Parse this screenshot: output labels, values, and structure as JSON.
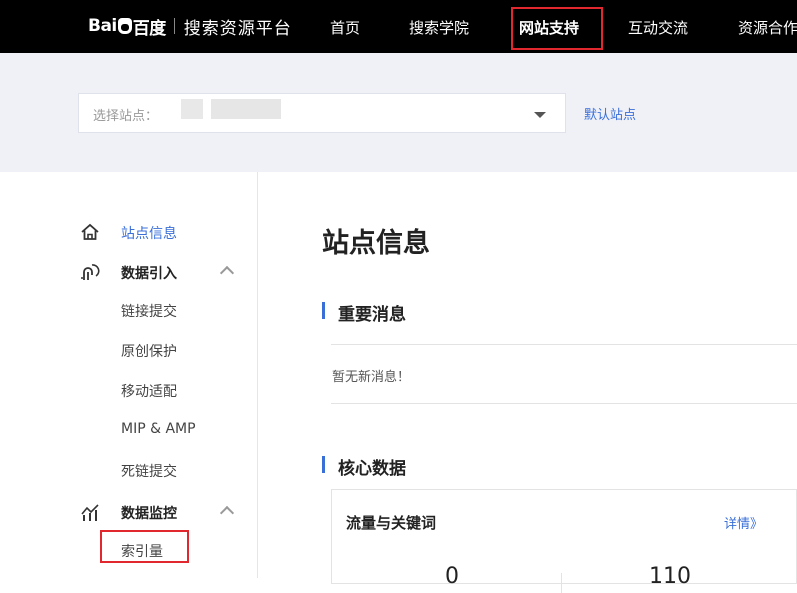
{
  "header": {
    "logo_text_left": "Bai",
    "logo_text_right": "百度",
    "logo_subtitle": "搜索资源平台",
    "nav": [
      "首页",
      "搜索学院",
      "网站支持",
      "互动交流",
      "资源合作"
    ],
    "active_nav": "网站支持"
  },
  "site_select": {
    "placeholder": "选择站点：",
    "default_link": "默认站点"
  },
  "sidebar": {
    "site_info": "站点信息",
    "data_import": "数据引入",
    "data_import_items": [
      "链接提交",
      "原创保护",
      "移动适配",
      "MIP & AMP",
      "死链提交"
    ],
    "data_monitor": "数据监控",
    "data_monitor_items": [
      "索引量"
    ]
  },
  "main": {
    "title": "站点信息",
    "important_msg_title": "重要消息",
    "no_msg": "暂无新消息！",
    "core_data_title": "核心数据",
    "card_title": "流量与关键词",
    "card_link": "详情》",
    "card_values": [
      "0",
      "110"
    ]
  },
  "colors": {
    "accent": "#3a6fd8",
    "highlight_box": "#e0282e",
    "band_bg": "#eff1f7"
  }
}
